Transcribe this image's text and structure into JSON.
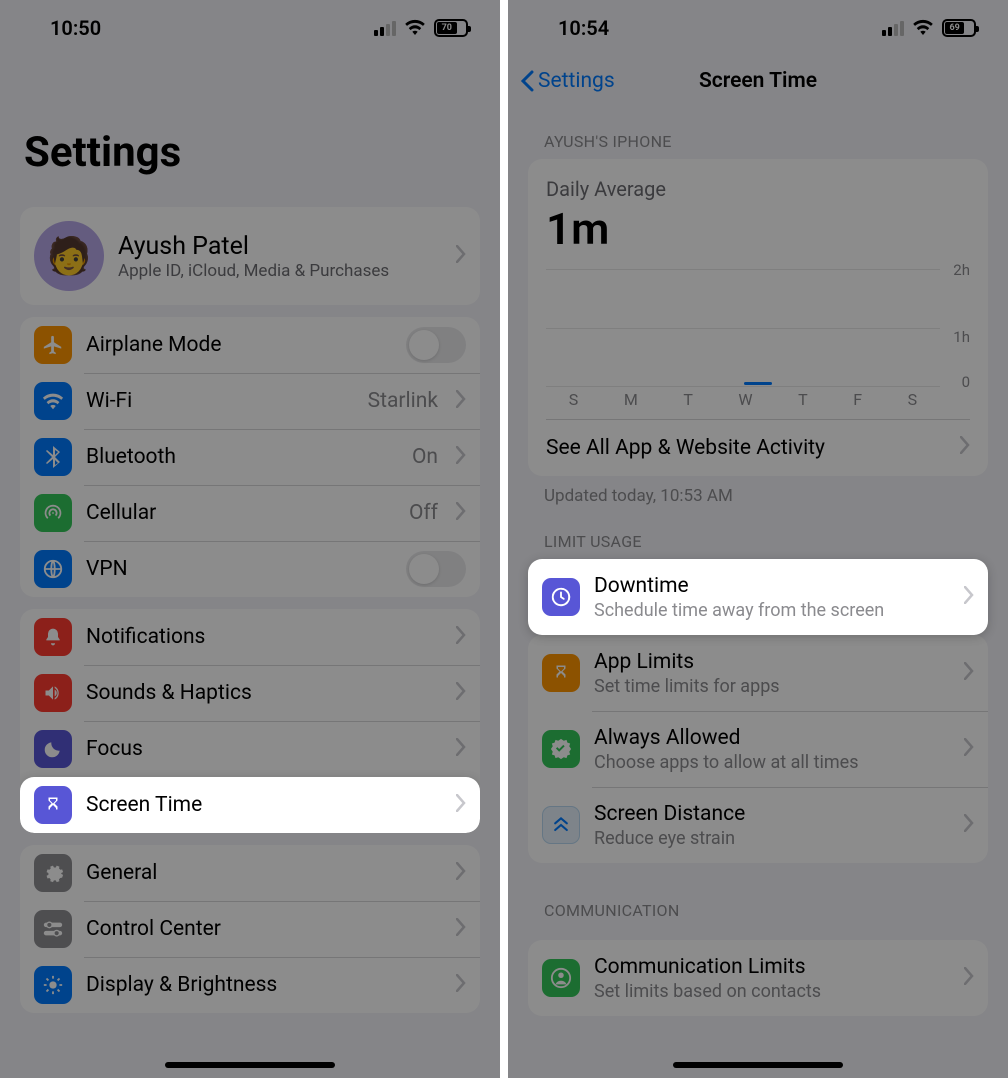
{
  "left": {
    "status": {
      "time": "10:50",
      "battery": "70"
    },
    "title": "Settings",
    "profile": {
      "name": "Ayush Patel",
      "sub": "Apple ID, iCloud, Media & Purchases"
    },
    "connectivity": [
      {
        "id": "airplane",
        "label": "Airplane Mode",
        "color": "#ff9500",
        "toggle": false
      },
      {
        "id": "wifi",
        "label": "Wi-Fi",
        "value": "Starlink",
        "color": "#007aff"
      },
      {
        "id": "bluetooth",
        "label": "Bluetooth",
        "value": "On",
        "color": "#007aff"
      },
      {
        "id": "cellular",
        "label": "Cellular",
        "value": "Off",
        "color": "#34c759"
      },
      {
        "id": "vpn",
        "label": "VPN",
        "color": "#007aff",
        "toggle": false
      }
    ],
    "notif_group": [
      {
        "id": "notifications",
        "label": "Notifications",
        "color": "#ff3b30"
      },
      {
        "id": "sounds",
        "label": "Sounds & Haptics",
        "color": "#ff3b30"
      },
      {
        "id": "focus",
        "label": "Focus",
        "color": "#5856d6"
      },
      {
        "id": "screentime",
        "label": "Screen Time",
        "color": "#5856d6",
        "highlight": true
      }
    ],
    "general_group": [
      {
        "id": "general",
        "label": "General",
        "color": "#8e8e93"
      },
      {
        "id": "controlcenter",
        "label": "Control Center",
        "color": "#8e8e93"
      },
      {
        "id": "display",
        "label": "Display & Brightness",
        "color": "#007aff"
      }
    ]
  },
  "right": {
    "status": {
      "time": "10:54",
      "battery": "69"
    },
    "nav": {
      "back": "Settings",
      "title": "Screen Time"
    },
    "section_device": "AYUSH'S IPHONE",
    "daily_label": "Daily Average",
    "daily_value": "1m",
    "see_all": "See All App & Website Activity",
    "updated": "Updated today, 10:53 AM",
    "section_limit": "LIMIT USAGE",
    "limit_rows": [
      {
        "id": "downtime",
        "title": "Downtime",
        "sub": "Schedule time away from the screen",
        "color": "#5856d6",
        "highlight": true
      },
      {
        "id": "applimits",
        "title": "App Limits",
        "sub": "Set time limits for apps",
        "color": "#ff9500"
      },
      {
        "id": "always",
        "title": "Always Allowed",
        "sub": "Choose apps to allow at all times",
        "color": "#34c759"
      },
      {
        "id": "distance",
        "title": "Screen Distance",
        "sub": "Reduce eye strain",
        "color": "#007aff"
      }
    ],
    "section_comm": "COMMUNICATION",
    "comm_rows": [
      {
        "id": "commlimits",
        "title": "Communication Limits",
        "sub": "Set limits based on contacts",
        "color": "#34c759"
      }
    ],
    "chart_data": {
      "type": "bar",
      "categories": [
        "S",
        "M",
        "T",
        "W",
        "T",
        "F",
        "S"
      ],
      "values": [
        0,
        0,
        0,
        0.05,
        0,
        0,
        0
      ],
      "ylabels": [
        "2h",
        "1h",
        "0"
      ],
      "ylim": [
        0,
        2
      ],
      "title": "Daily Average",
      "xlabel": "",
      "ylabel": ""
    }
  }
}
